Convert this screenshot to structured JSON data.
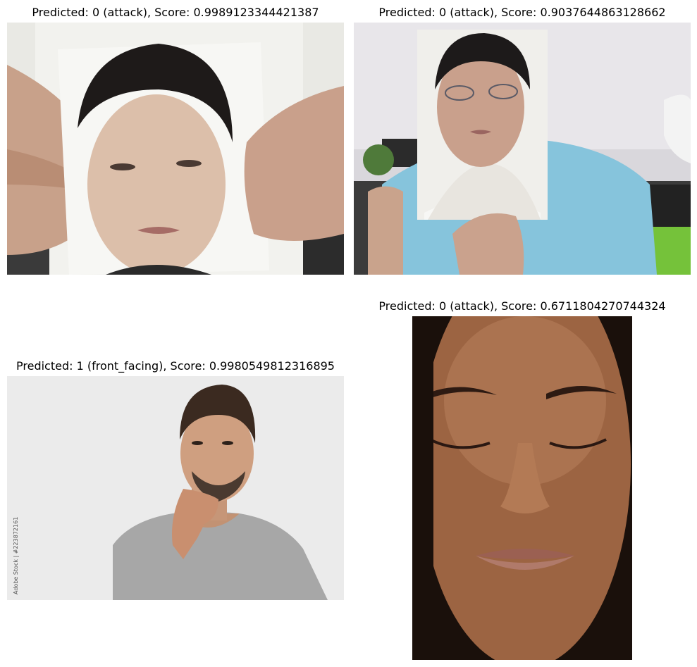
{
  "panels": [
    {
      "title": "Predicted: 0 (attack), Score: 0.9989123344421387",
      "image": "photo-print-held-by-hands"
    },
    {
      "title": "Predicted: 0 (attack), Score: 0.9037644863128662",
      "image": "photo-print-held-in-office"
    },
    {
      "title": "Predicted: 1 (front_facing), Score: 0.9980549812316895",
      "image": "man-thinking-stock-photo",
      "watermark": "Adobe Stock | #223872161"
    },
    {
      "title": "Predicted: 0 (attack), Score: 0.6711804270744324",
      "image": "woman-closed-eyes-closeup"
    }
  ]
}
